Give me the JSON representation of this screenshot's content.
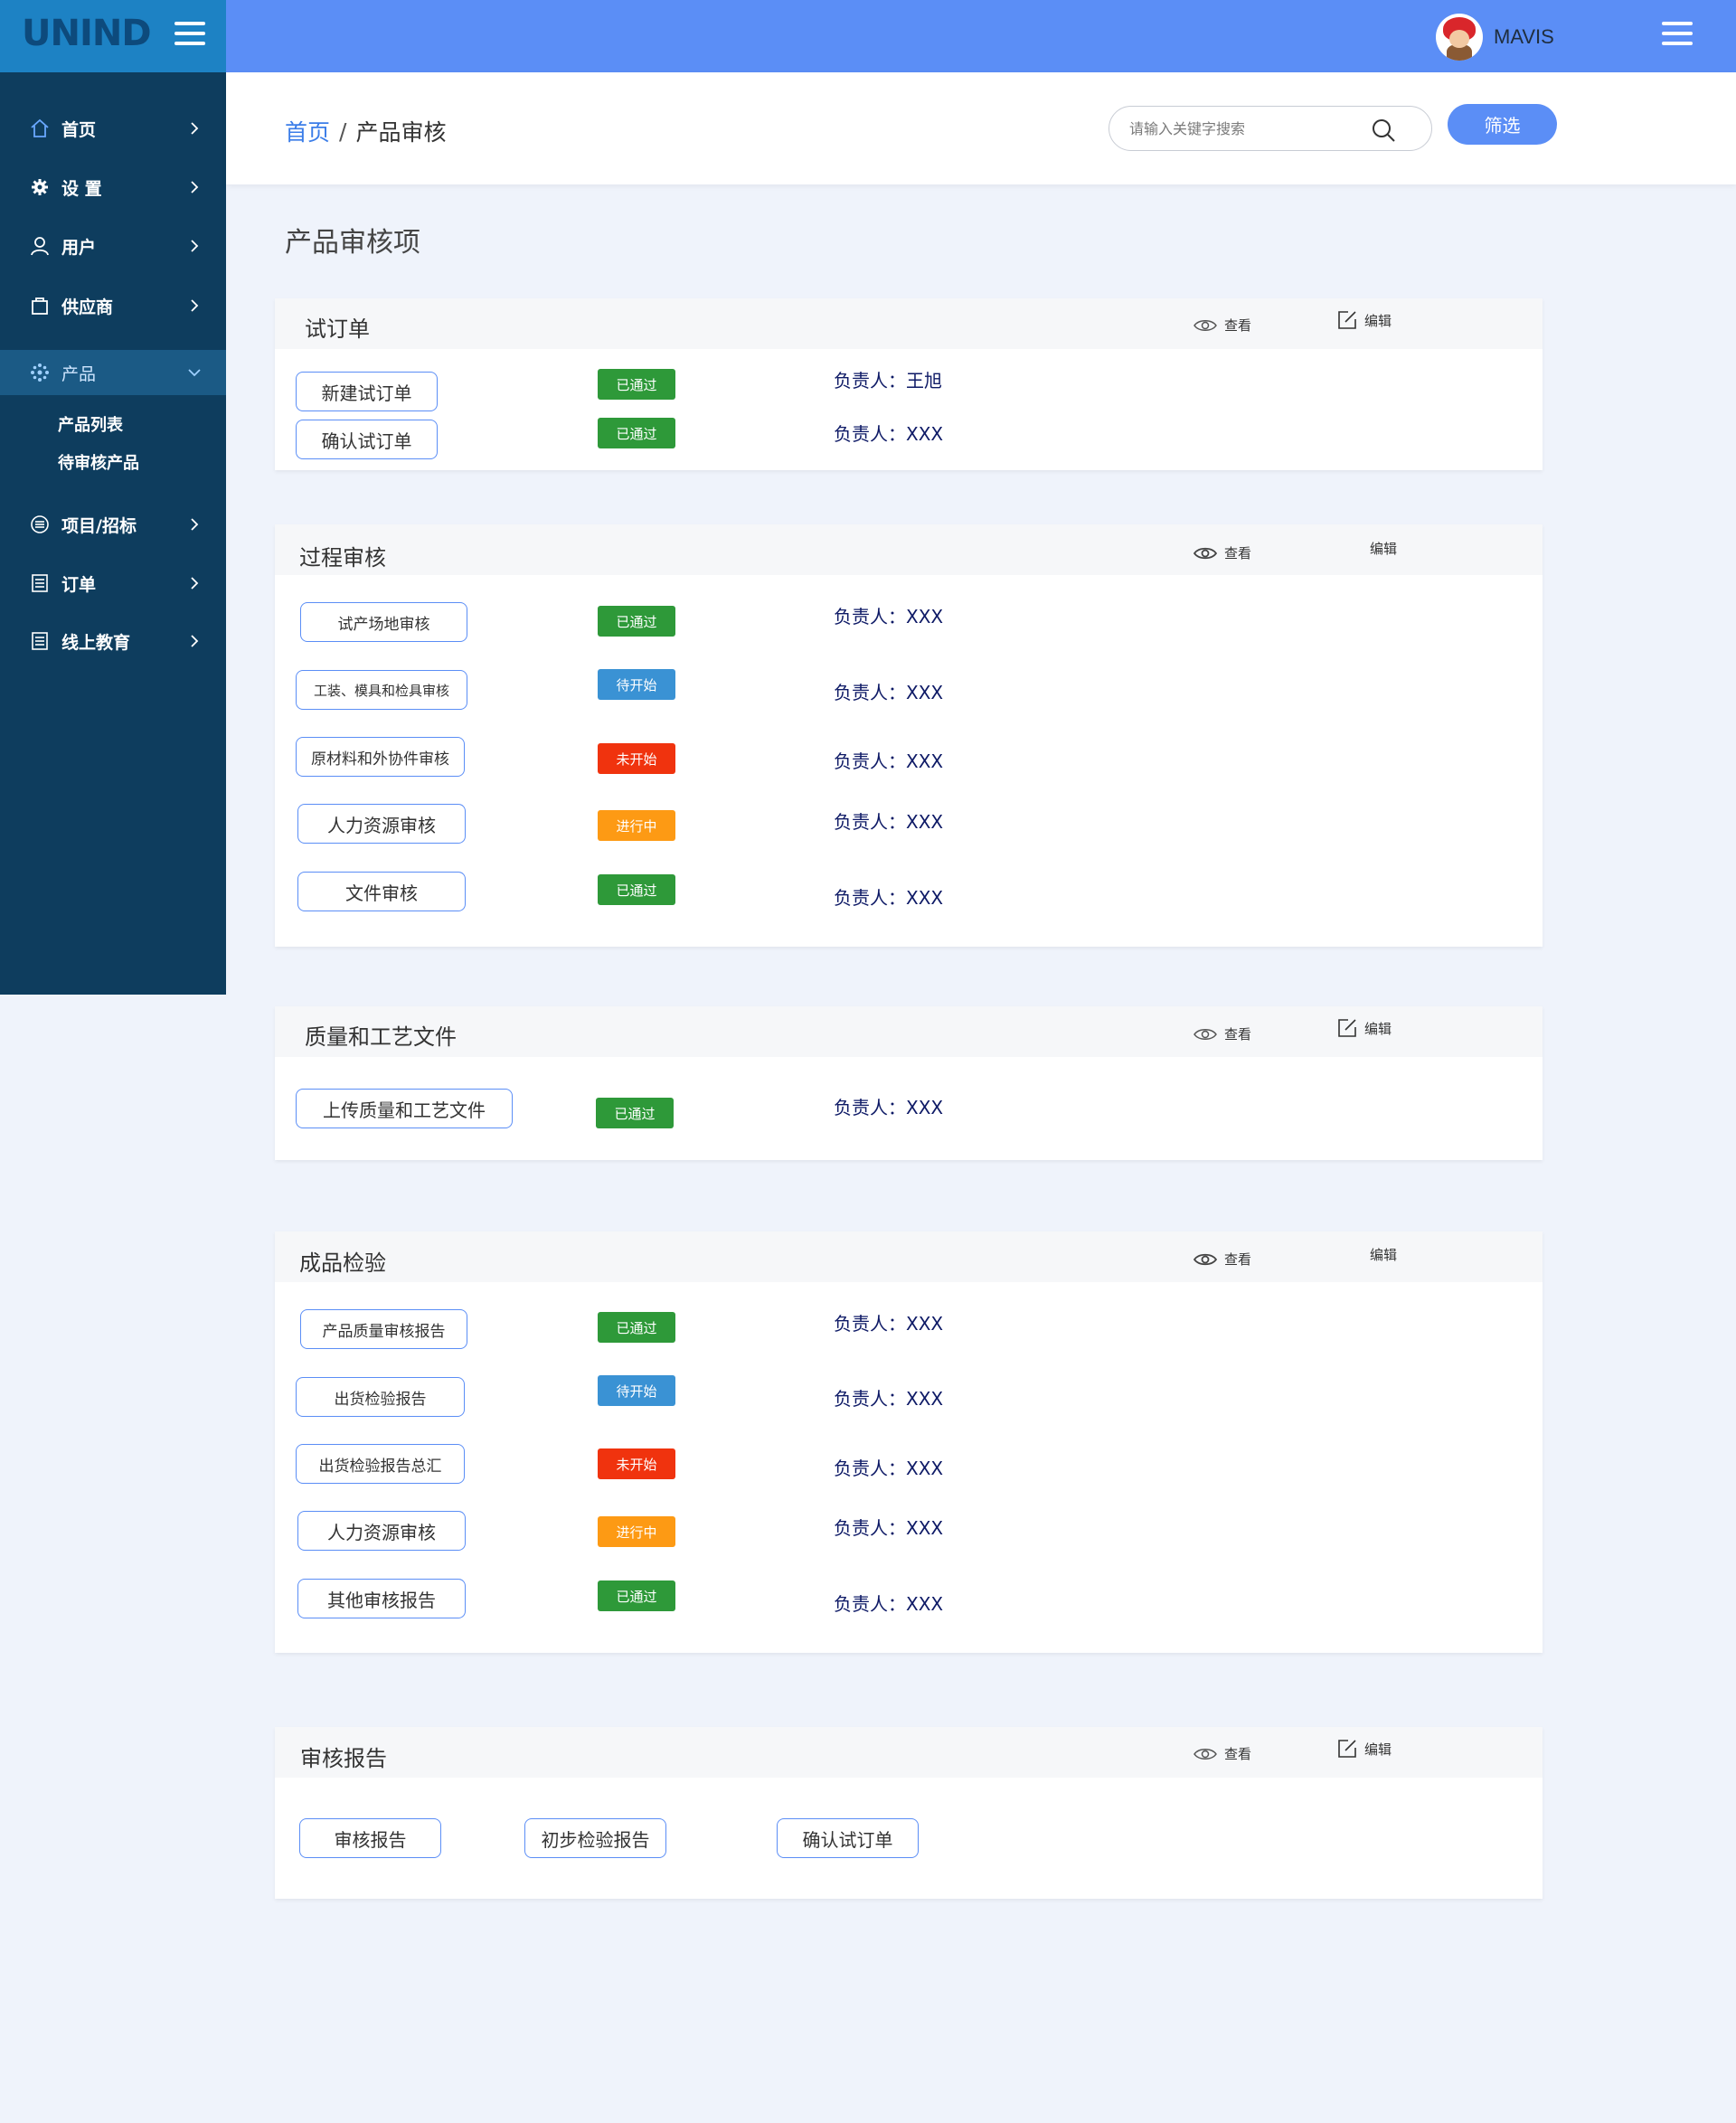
{
  "app": {
    "logo": "UNIND",
    "username": "MAVIS"
  },
  "sidebar": {
    "items": [
      {
        "label": "首页",
        "icon": "home-icon"
      },
      {
        "label": "设 置",
        "icon": "gear-icon"
      },
      {
        "label": "用户",
        "icon": "user-icon"
      },
      {
        "label": "供应商",
        "icon": "bag-icon"
      },
      {
        "label": "产品",
        "icon": "product-icon"
      },
      {
        "label": "项目/招标",
        "icon": "list-icon"
      },
      {
        "label": "订单",
        "icon": "document-icon"
      },
      {
        "label": "线上教育",
        "icon": "document-icon"
      }
    ],
    "subitems": [
      "产品列表",
      "待审核产品"
    ]
  },
  "breadcrumb": {
    "home": "首页",
    "separator": "/",
    "current": "产品审核"
  },
  "search": {
    "placeholder": "请输入关键字搜索"
  },
  "filter_label": "筛选",
  "page_title": "产品审核项",
  "actions": {
    "view": "查看",
    "edit": "编辑"
  },
  "sections": [
    {
      "title": "试订单",
      "rows": [
        {
          "label": "新建试订单",
          "status": "已通过",
          "owner": "负责人：王旭"
        },
        {
          "label": "确认试订单",
          "status": "已通过",
          "owner": "负责人：XXX"
        }
      ]
    },
    {
      "title": "过程审核",
      "rows": [
        {
          "label": "试产场地审核",
          "status": "已通过",
          "owner": "负责人：XXX"
        },
        {
          "label": "工装、模具和检具审核",
          "status": "待开始",
          "owner": "负责人：XXX"
        },
        {
          "label": "原材料和外协件审核",
          "status": "未开始",
          "owner": "负责人：XXX"
        },
        {
          "label": "人力资源审核",
          "status": "进行中",
          "owner": "负责人：XXX"
        },
        {
          "label": "文件审核",
          "status": "已通过",
          "owner": "负责人：XXX"
        }
      ]
    },
    {
      "title": "质量和工艺文件",
      "rows": [
        {
          "label": "上传质量和工艺文件",
          "status": "已通过",
          "owner": "负责人：XXX"
        }
      ]
    },
    {
      "title": "成品检验",
      "rows": [
        {
          "label": "产品质量审核报告",
          "status": "已通过",
          "owner": "负责人：XXX"
        },
        {
          "label": "出货检验报告",
          "status": "待开始",
          "owner": "负责人：XXX"
        },
        {
          "label": "出货检验报告总汇",
          "status": "未开始",
          "owner": "负责人：XXX"
        },
        {
          "label": "人力资源审核",
          "status": "进行中",
          "owner": "负责人：XXX"
        },
        {
          "label": "其他审核报告",
          "status": "已通过",
          "owner": "负责人：XXX"
        }
      ]
    },
    {
      "title": "审核报告",
      "buttons": [
        "审核报告",
        "初步检验报告",
        "确认试订单"
      ]
    }
  ],
  "status_colors": {
    "已通过": "#2e9939",
    "待开始": "#3a92d4",
    "未开始": "#f0330e",
    "进行中": "#fd9a14"
  }
}
